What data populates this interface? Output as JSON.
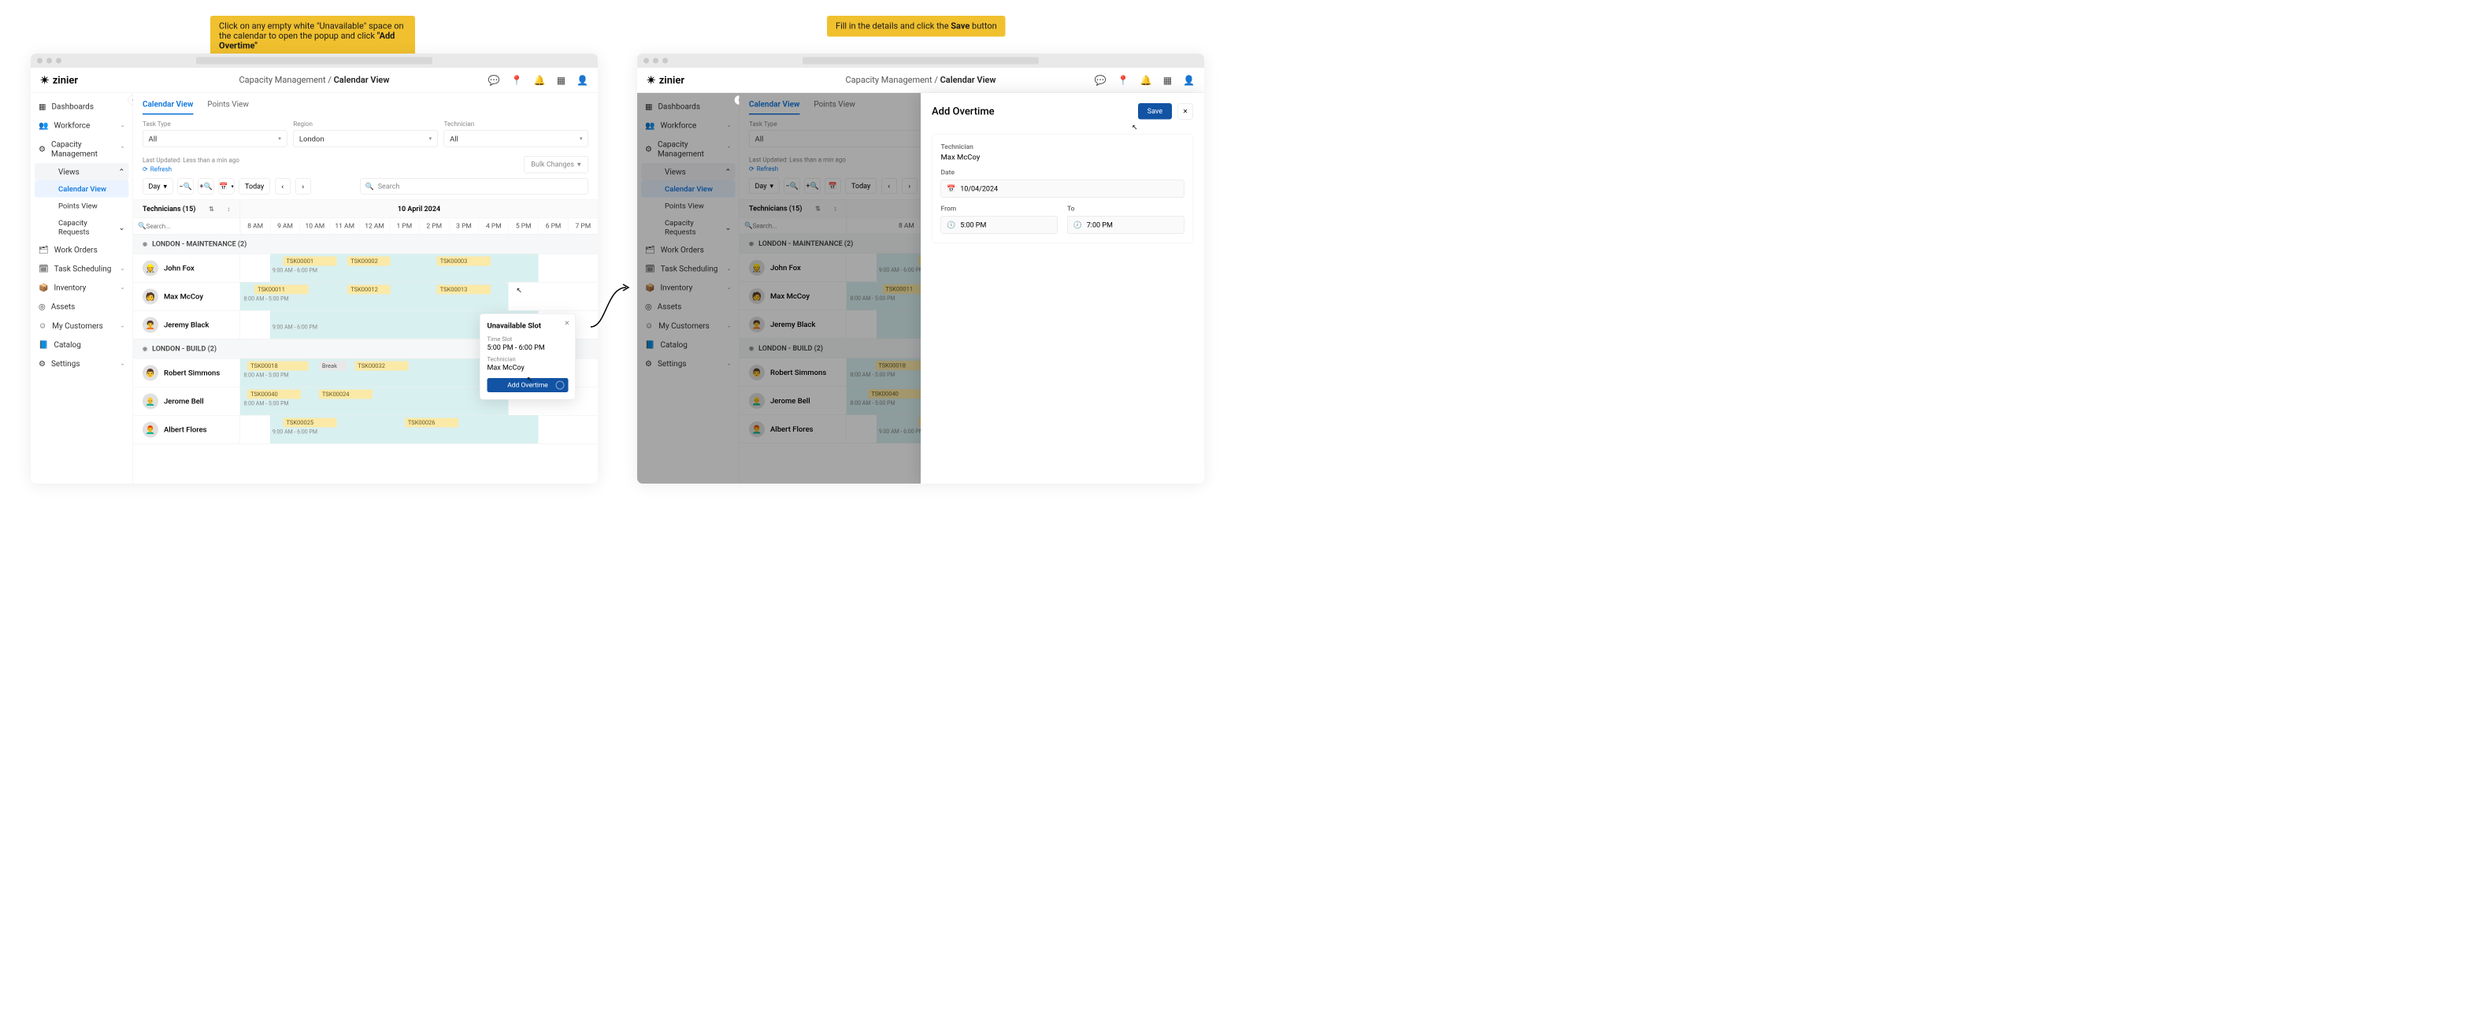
{
  "callouts": {
    "left_prefix": "Click on any empty white \"Unavailable\" space on the calendar to open the popup and click ",
    "left_bold": "\"Add Overtime\"",
    "right_prefix": "Fill in the details and click the ",
    "right_bold": "Save",
    "right_suffix": " button"
  },
  "brand": "zinier",
  "breadcrumb": {
    "parent": "Capacity Management",
    "sep": "/",
    "current": "Calendar View"
  },
  "sidebar": {
    "dashboards": "Dashboards",
    "workforce": "Workforce",
    "capacity": "Capacity Management",
    "views": "Views",
    "calendar_view": "Calendar View",
    "points_view": "Points View",
    "capacity_requests": "Capacity Requests",
    "work_orders": "Work Orders",
    "task_scheduling": "Task Scheduling",
    "inventory": "Inventory",
    "assets": "Assets",
    "my_customers": "My Customers",
    "catalog": "Catalog",
    "settings": "Settings"
  },
  "tabs": {
    "calendar": "Calendar View",
    "points": "Points View"
  },
  "filters": {
    "task_type_label": "Task Type",
    "task_type_value": "All",
    "region_label": "Region",
    "region_value": "London",
    "tech_label": "Technician",
    "tech_value": "All"
  },
  "meta": {
    "updated": "Last Updated: Less than a min ago",
    "refresh": "Refresh",
    "bulk": "Bulk Changes"
  },
  "toolbar": {
    "view": "Day",
    "today": "Today",
    "search": "Search"
  },
  "tech_header": {
    "title": "Technicians (15)",
    "date": "10 April 2024",
    "search": "Search..."
  },
  "hours": [
    "8 AM",
    "9 AM",
    "10 AM",
    "11 AM",
    "12 AM",
    "1 PM",
    "2 PM",
    "3 PM",
    "4 PM",
    "5 PM",
    "6 PM",
    "7 PM"
  ],
  "groups": {
    "g1": "LONDON - MAINTENANCE (2)",
    "g2": "LONDON - BUILD (2)"
  },
  "technicians": {
    "john": "John Fox",
    "max": "Max McCoy",
    "jeremy": "Jeremy Black",
    "robert": "Robert Simmons",
    "jerome": "Jerome Bell",
    "albert": "Albert Flores"
  },
  "schedule": {
    "john_hours": "9:00 AM - 6:00 PM",
    "john_tasks": [
      "TSK00001",
      "TSK00002",
      "TSK00003"
    ],
    "max_hours": "8:00 AM - 5:00 PM",
    "max_tasks": [
      "TSK00011",
      "TSK00012",
      "TSK00013"
    ],
    "jeremy_hours": "9:00 AM - 6:00 PM",
    "robert_hours": "8:00 AM - 5:00 PM",
    "robert_tasks": [
      "TSK00018",
      "Break",
      "TSK00032"
    ],
    "jerome_hours": "8:00 AM - 5:00 PM",
    "jerome_tasks": [
      "TSK00040",
      "TSK00024"
    ],
    "albert_hours": "9:00 AM - 6:00 PM",
    "albert_tasks": [
      "TSK00025",
      "TSK00026"
    ]
  },
  "popup": {
    "title": "Unavailable Slot",
    "slot_label": "Time Slot",
    "slot_value": "5:00 PM - 6:00 PM",
    "tech_label": "Technician",
    "tech_value": "Max McCoy",
    "button": "Add Overtime"
  },
  "panel": {
    "title": "Add Overtime",
    "save": "Save",
    "tech_label": "Technician",
    "tech_value": "Max McCoy",
    "date_label": "Date",
    "date_value": "10/04/2024",
    "from_label": "From",
    "from_value": "5:00 PM",
    "to_label": "To",
    "to_value": "7:00 PM"
  }
}
